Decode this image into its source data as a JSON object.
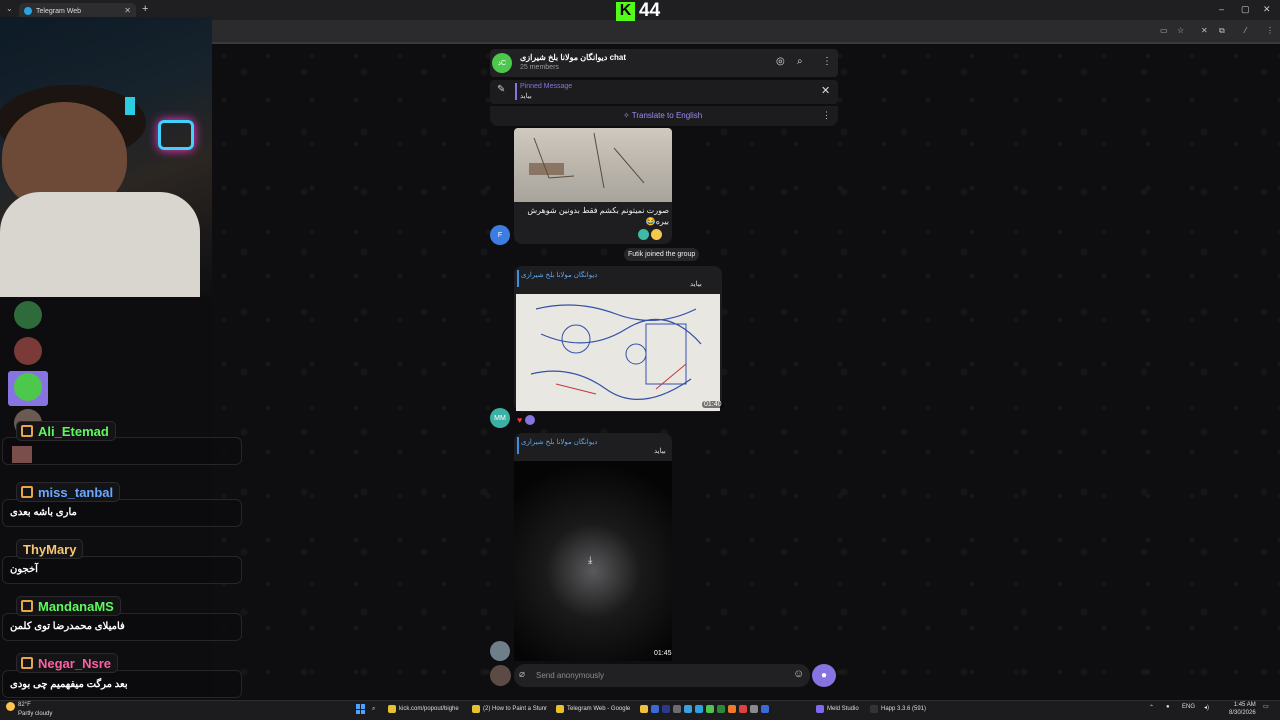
{
  "browser": {
    "tab_title": "Telegram Web",
    "tab_close": "✕",
    "new_tab": "+",
    "tab_menu": "⌄",
    "window_controls": [
      "–",
      "▢",
      "✕"
    ]
  },
  "overlay": {
    "kick_letter": "K",
    "viewer_count": "44"
  },
  "chat": {
    "avatar_initials": "ذC",
    "title": "دیوانگان مولانا بلخ شیرازی chat",
    "members": "25 members",
    "pinned_label": "Pinned Message",
    "pinned_text": "بیاید",
    "translate_label": "Translate to English",
    "join_notice": "Futik joined the group"
  },
  "messages": {
    "caption1": "صورت نمیتونم بکشم فقط بدونین شوهرش بیره😂",
    "sender_f": "F",
    "forward_name": "دیوانگان مولانا بلخ شیرازی",
    "forward_text": "بیاید",
    "duration2": "01:40",
    "sender_mm": "MM",
    "duration3": "01:45"
  },
  "composer": {
    "placeholder": "Send anonymously"
  },
  "kick_chat": [
    {
      "name": "Ali_Etemad",
      "message": "",
      "color": "#5dfa5d"
    },
    {
      "name": "miss_tanbal",
      "message": "ماری باشه بعدی",
      "color": "#6aa8ff"
    },
    {
      "name": "ThyMary",
      "message": "آخجون",
      "color": "#f7c873"
    },
    {
      "name": "MandanaMS",
      "message": "فامیلای محمدرضا توی کلمن",
      "color": "#5dfa5d"
    },
    {
      "name": "Negar_Nsre",
      "message": "بعد مرگت میفهمیم چی بودی",
      "color": "#ff5fa2"
    }
  ],
  "taskbar": {
    "weather_temp": "82°F",
    "weather_desc": "Partly cloudy",
    "items": [
      "kick.com/popout/bighe",
      "(2) How to Paint a Stunr",
      "Telegram Web - Google",
      "Meld Studio",
      "Happ 3.3.6 (591)"
    ],
    "lang": "ENG",
    "time": "1:45 AM",
    "date": "8/30/2026"
  }
}
